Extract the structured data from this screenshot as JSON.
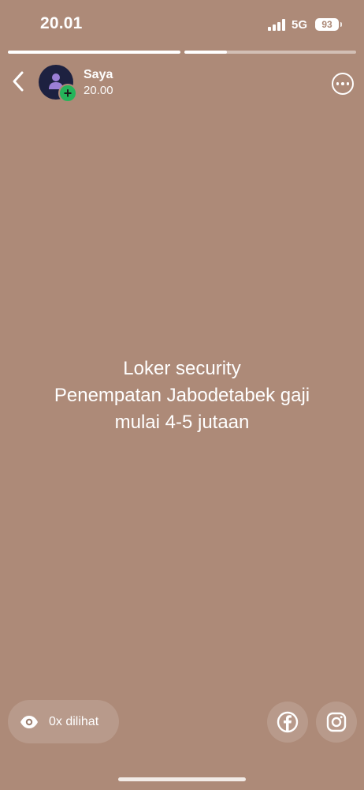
{
  "status_bar": {
    "time": "20.01",
    "network": "5G",
    "battery": "93"
  },
  "progress": {
    "segments": [
      {
        "fill": 1.0
      },
      {
        "fill": 0.25
      }
    ]
  },
  "header": {
    "user_name": "Saya",
    "post_time": "20.00"
  },
  "story": {
    "lines": [
      "Loker security",
      "Penempatan Jabodetabek gaji",
      "mulai 4-5 jutaan"
    ],
    "background_color": "#ad8a78"
  },
  "footer": {
    "views_label": "0x dilihat"
  },
  "icons": {
    "back": "chevron-left-icon",
    "more": "more-icon",
    "views": "eye-icon",
    "facebook": "facebook-icon",
    "instagram": "instagram-icon",
    "add": "plus-icon"
  },
  "colors": {
    "add_badge": "#25b45a",
    "avatar_bg": "#1d2140"
  }
}
